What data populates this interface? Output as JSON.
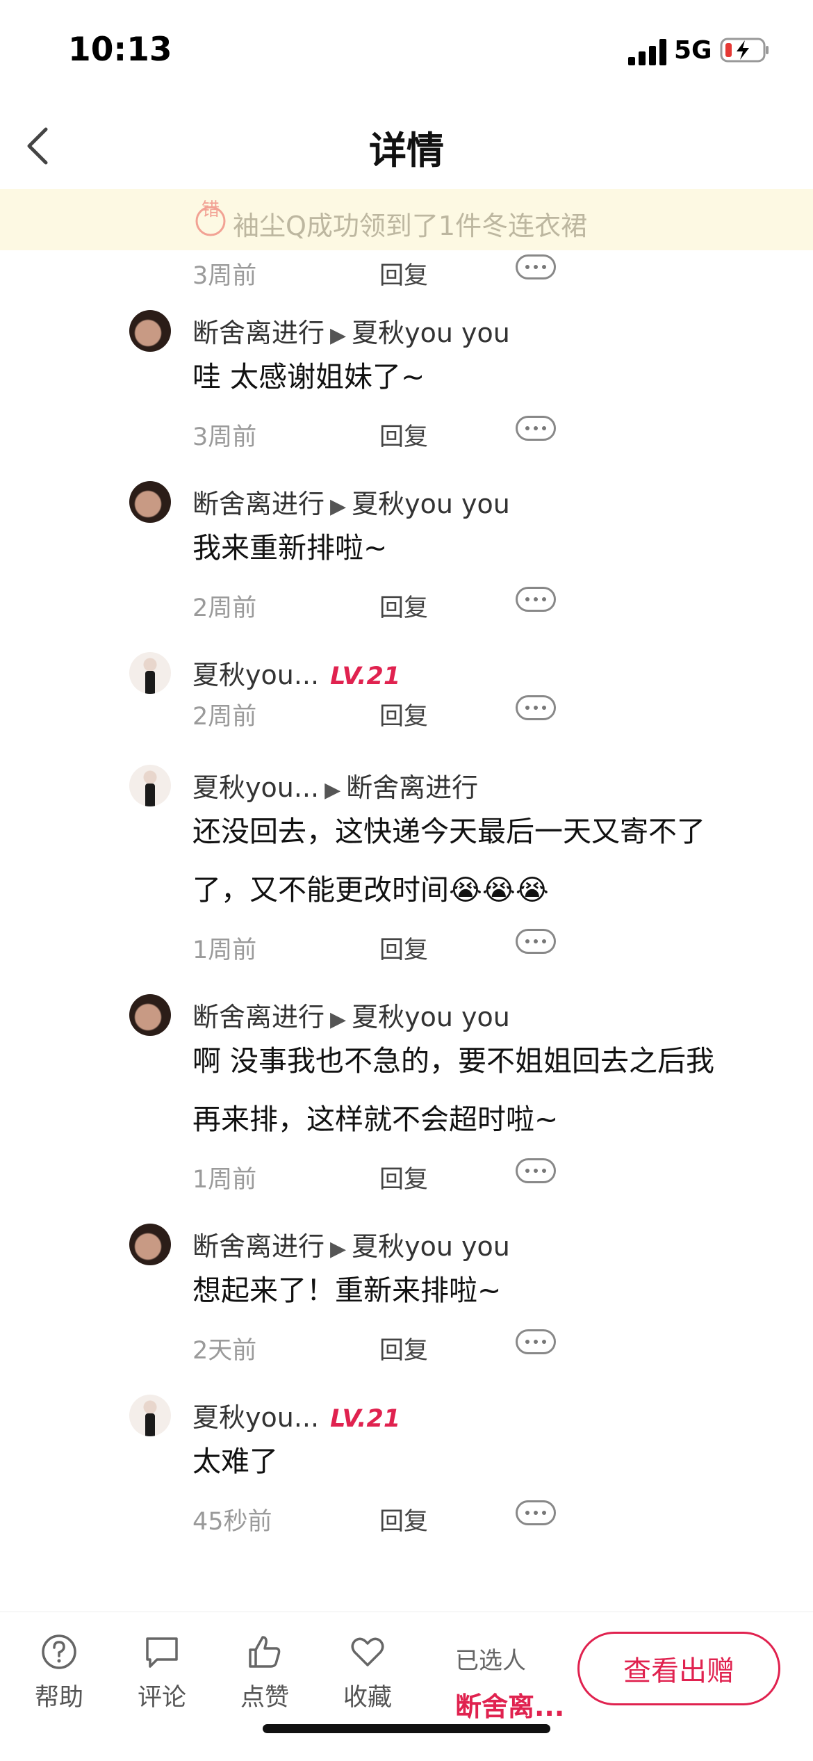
{
  "status_bar": {
    "time": "10:13",
    "network": "5G"
  },
  "header": {
    "title": "详情"
  },
  "banner": {
    "badge_char": "错",
    "text": "袖尘Q成功领到了1件冬连衣裙"
  },
  "reply_label": "回复",
  "first_meta": {
    "time": "3周前"
  },
  "comments": [
    {
      "author": "断舍离进行",
      "target": "夏秋you you",
      "level": "",
      "lines": [
        "哇 太感谢姐妹了~"
      ],
      "time": "3周前"
    },
    {
      "author": "断舍离进行",
      "target": "夏秋you you",
      "level": "",
      "lines": [
        "我来重新排啦~"
      ],
      "time": "2周前"
    },
    {
      "author": "夏秋you...",
      "target": "",
      "level": "LV.21",
      "lines": [],
      "time": "2周前"
    },
    {
      "author": "夏秋you...",
      "target": "断舍离进行",
      "level": "",
      "lines": [
        "还没回去，这快递今天最后一天又寄不了",
        "了，又不能更改时间😭😭😭"
      ],
      "time": "1周前"
    },
    {
      "author": "断舍离进行",
      "target": "夏秋you you",
      "level": "",
      "lines": [
        "啊 没事我也不急的，要不姐姐回去之后我",
        "再来排，这样就不会超时啦~"
      ],
      "time": "1周前"
    },
    {
      "author": "断舍离进行",
      "target": "夏秋you you",
      "level": "",
      "lines": [
        "想起来了！重新来排啦~"
      ],
      "time": "2天前"
    },
    {
      "author": "夏秋you...",
      "target": "",
      "level": "LV.21",
      "lines": [
        "太难了"
      ],
      "time": "45秒前"
    }
  ],
  "bottom_bar": {
    "help": "帮助",
    "comment": "评论",
    "like": "点赞",
    "favorite": "收藏",
    "picked_label": "已选人",
    "picked_name": "断舍离...",
    "cta": "查看出赠"
  },
  "colors": {
    "accent": "#e0224f",
    "banner_bg": "#fdf9e3"
  }
}
